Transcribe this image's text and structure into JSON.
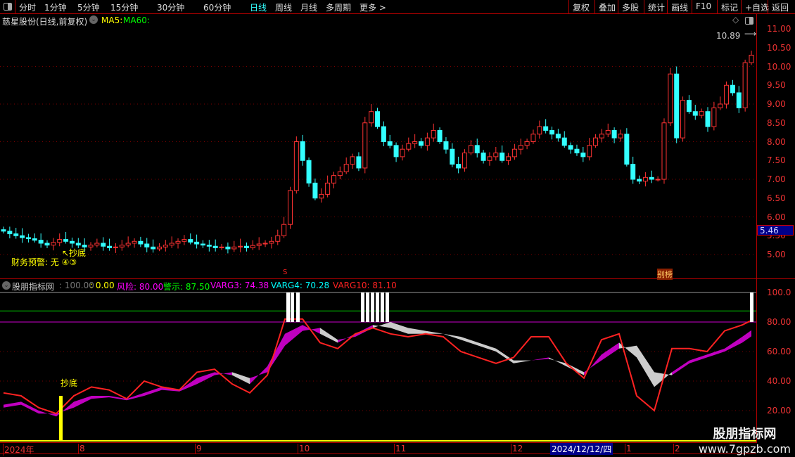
{
  "toolbar": {
    "periods": [
      "分时",
      "1分钟",
      "5分钟",
      "15分钟",
      "30分钟",
      "60分钟",
      "日线",
      "周线",
      "月线",
      "多周期",
      "更多 >"
    ],
    "selected": "日线",
    "buttons": [
      "复权",
      "叠加",
      "多股",
      "统计",
      "画线",
      "F10",
      "标记",
      "+自选",
      "返回"
    ]
  },
  "main": {
    "title": "慈星股份(日线,前复权)",
    "ma5": "MA5:",
    "ma60": "MA60:",
    "high_label": "10.89",
    "current_price": "5.46",
    "signal_label": "↖抄底",
    "fin_warning": "财务预警: 无 ④③",
    "marker_s": "S",
    "marker_bang": "别榜",
    "price_ticks": [
      "11.00",
      "10.50",
      "10.00",
      "9.50",
      "9.00",
      "8.50",
      "8.00",
      "7.50",
      "7.00",
      "6.50",
      "6.00",
      "5.50",
      "5.00"
    ]
  },
  "indicator": {
    "name": "股朋指标网",
    "v1": ": 100.00",
    "v2": ": 0.00",
    "risk": "风险: 80.00",
    "warn": "警示: 87.50",
    "varg3": "VARG3: 74.38",
    "varg4": "VARG4: 70.28",
    "varg10": "VARG10: 81.10",
    "ticks": [
      "100.0",
      "80.00",
      "60.00",
      "40.00",
      "20.00"
    ],
    "signal_label": "抄底"
  },
  "time_axis": {
    "labels": [
      "2024年",
      "8",
      "9",
      "10",
      "11",
      "12",
      "1",
      "2"
    ],
    "cursor_date": "2024/12/12/四"
  },
  "watermark": {
    "title": "股朋指标网",
    "url": "www.7gpzb.com"
  },
  "colors": {
    "up": "#ff3333",
    "down": "#33ffff",
    "accent": "#b00000",
    "magenta": "#cc00cc"
  },
  "chart_data": {
    "type": "candlestick",
    "closes": [
      5.62,
      5.55,
      5.5,
      5.45,
      5.42,
      5.38,
      5.3,
      5.25,
      5.32,
      5.4,
      5.35,
      5.3,
      5.25,
      5.2,
      5.25,
      5.3,
      5.22,
      5.18,
      5.2,
      5.25,
      5.3,
      5.35,
      5.28,
      5.2,
      5.15,
      5.2,
      5.25,
      5.3,
      5.35,
      5.4,
      5.33,
      5.28,
      5.25,
      5.22,
      5.18,
      5.2,
      5.15,
      5.2,
      5.22,
      5.18,
      5.24,
      5.28,
      5.3,
      5.35,
      5.5,
      5.8,
      6.7,
      8.0,
      7.5,
      6.9,
      6.5,
      6.6,
      6.9,
      7.1,
      7.2,
      7.4,
      7.6,
      7.3,
      8.5,
      8.8,
      8.4,
      8.0,
      7.9,
      7.6,
      7.8,
      7.95,
      8.0,
      7.9,
      8.1,
      8.3,
      8.0,
      7.8,
      7.4,
      7.3,
      7.7,
      7.9,
      7.7,
      7.5,
      7.6,
      7.7,
      7.5,
      7.6,
      7.8,
      7.9,
      8.0,
      8.2,
      8.4,
      8.3,
      8.2,
      8.1,
      7.9,
      7.8,
      7.7,
      7.6,
      7.9,
      8.1,
      8.2,
      8.3,
      8.1,
      8.2,
      7.4,
      7.0,
      6.95,
      7.05,
      7.0,
      7.0,
      8.5,
      9.8,
      8.1,
      9.1,
      8.8,
      8.7,
      8.8,
      8.4,
      8.9,
      9.0,
      9.5,
      9.3,
      8.9,
      10.1,
      10.3
    ],
    "price_range": [
      4.6,
      11.4
    ],
    "indicator": {
      "range": [
        10,
        105
      ],
      "sample_index": [
        0,
        1,
        2,
        3,
        4,
        5,
        6,
        7,
        8,
        9,
        10,
        11,
        12,
        13,
        14,
        15,
        16,
        17,
        18,
        19,
        20,
        21,
        22,
        23,
        24,
        25,
        26,
        27,
        28,
        29,
        30,
        31,
        32,
        33,
        34,
        35,
        36,
        37,
        38,
        39,
        40,
        41,
        42,
        43
      ],
      "varg10": [
        32,
        30,
        22,
        18,
        30,
        36,
        34,
        28,
        40,
        36,
        34,
        46,
        48,
        38,
        32,
        44,
        82,
        82,
        66,
        62,
        72,
        76,
        72,
        70,
        72,
        70,
        60,
        56,
        52,
        56,
        70,
        70,
        52,
        42,
        68,
        72,
        30,
        20,
        62,
        62,
        60,
        74,
        78,
        81.1
      ],
      "varg3": [
        24,
        26,
        20,
        16,
        26,
        30,
        30,
        28,
        32,
        36,
        34,
        42,
        46,
        44,
        38,
        50,
        72,
        78,
        72,
        66,
        72,
        78,
        76,
        72,
        72,
        72,
        68,
        64,
        60,
        52,
        54,
        56,
        50,
        44,
        58,
        66,
        56,
        36,
        46,
        54,
        58,
        62,
        70,
        74.38
      ],
      "varg4": [
        22,
        24,
        18,
        18,
        22,
        28,
        29,
        27,
        30,
        34,
        33,
        38,
        44,
        46,
        42,
        46,
        64,
        74,
        76,
        68,
        70,
        76,
        80,
        76,
        74,
        72,
        70,
        66,
        62,
        54,
        54,
        55,
        52,
        46,
        54,
        62,
        64,
        46,
        44,
        52,
        56,
        60,
        66,
        70.28
      ],
      "risk_level": 80,
      "warn_level": 87.5,
      "top_level": 100,
      "warning_bars_candle_index": [
        45,
        46,
        47,
        57,
        58,
        59,
        60,
        61,
        62,
        120
      ],
      "buy_signal_candle_index": [
        9
      ]
    }
  }
}
